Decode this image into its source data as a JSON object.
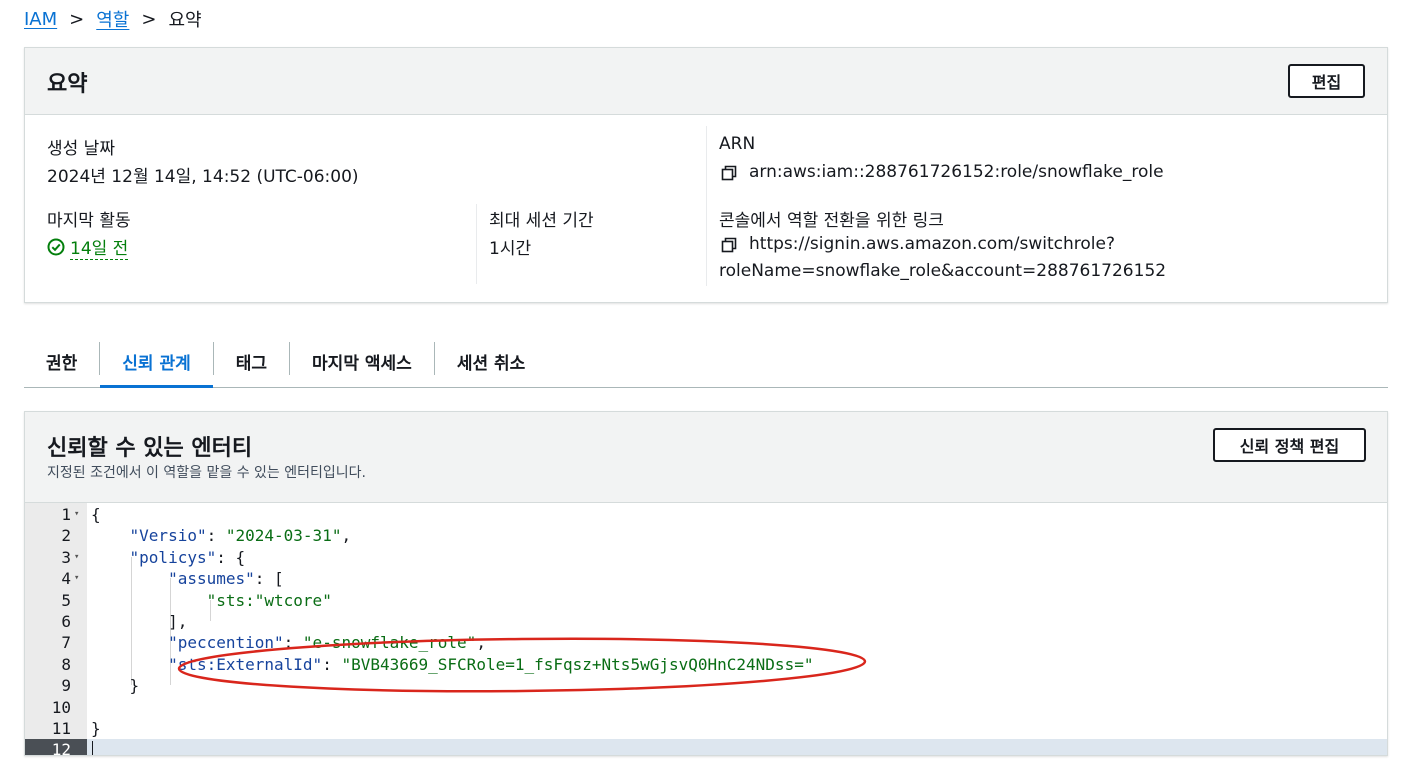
{
  "breadcrumb": {
    "items": [
      "IAM",
      "역할"
    ],
    "separator": ">",
    "current": "요약"
  },
  "summary": {
    "title": "요약",
    "edit_button": "편집",
    "created_label": "생성 날짜",
    "created_value": "2024년 12월 14일, 14:52 (UTC-06:00)",
    "last_activity_label": "마지막 활동",
    "last_activity_value": "14일 전",
    "max_session_label": "최대 세션 기간",
    "max_session_value": "1시간",
    "arn_label": "ARN",
    "arn_value": "arn:aws:iam::288761726152:role/snowflake_role",
    "switch_link_label": "콘솔에서 역할 전환을 위한 링크",
    "switch_link_line1": "https://signin.aws.amazon.com/switchrole?",
    "switch_link_line2": "roleName=snowflake_role&account=288761726152"
  },
  "tabs": [
    {
      "label": "권한",
      "active": false
    },
    {
      "label": "신뢰 관계",
      "active": true
    },
    {
      "label": "태그",
      "active": false
    },
    {
      "label": "마지막 액세스",
      "active": false
    },
    {
      "label": "세션 취소",
      "active": false
    }
  ],
  "trust": {
    "title": "신뢰할 수 있는 엔터티",
    "description": "지정된 조건에서 이 역할을 맡을 수 있는 엔터티입니다.",
    "edit_button": "신뢰 정책 편집"
  },
  "code": {
    "active_line": 12,
    "lines": [
      {
        "n": "1",
        "fold": true,
        "t": "{"
      },
      {
        "n": "2",
        "fold": false,
        "k": "\"Versio\"",
        "p": ": ",
        "s": "\"2024-03-31\"",
        "e": ",",
        "indent": "    "
      },
      {
        "n": "3",
        "fold": true,
        "k": "\"policys\"",
        "p": ": {",
        "s": "",
        "e": "",
        "indent": "    "
      },
      {
        "n": "4",
        "fold": true,
        "k": "\"assumes\"",
        "p": ": [",
        "s": "",
        "e": "",
        "indent": "        "
      },
      {
        "n": "5",
        "fold": false,
        "k": "",
        "p": "",
        "s": "\"sts:\"wtcore\"",
        "e": "",
        "indent": "            "
      },
      {
        "n": "6",
        "fold": false,
        "t": "        ],"
      },
      {
        "n": "7",
        "fold": false,
        "k": "\"peccention\"",
        "p": ": ",
        "s": "\"e-snowflake_role\"",
        "e": ",",
        "indent": "        "
      },
      {
        "n": "8",
        "fold": false,
        "k": "\"sts:ExternalId\"",
        "p": ": ",
        "s": "\"BVB43669_SFCRole=1_fsFqsz+Nts5wGjsvQ0HnC24NDss=\"",
        "e": "",
        "indent": "        "
      },
      {
        "n": "9",
        "fold": false,
        "t": "    }"
      },
      {
        "n": "10",
        "fold": false,
        "t": ""
      },
      {
        "n": "11",
        "fold": false,
        "t": "}"
      },
      {
        "n": "12",
        "fold": false,
        "t": ""
      }
    ]
  },
  "colors": {
    "link": "#0972d3",
    "success": "#037f0c",
    "json_key": "#16439c",
    "json_string": "#0a6d15",
    "highlight_ellipse": "#d9261c"
  },
  "icons": [
    "chevron-right-icon",
    "copy-icon",
    "status-success-icon",
    "fold-arrow-icon"
  ]
}
